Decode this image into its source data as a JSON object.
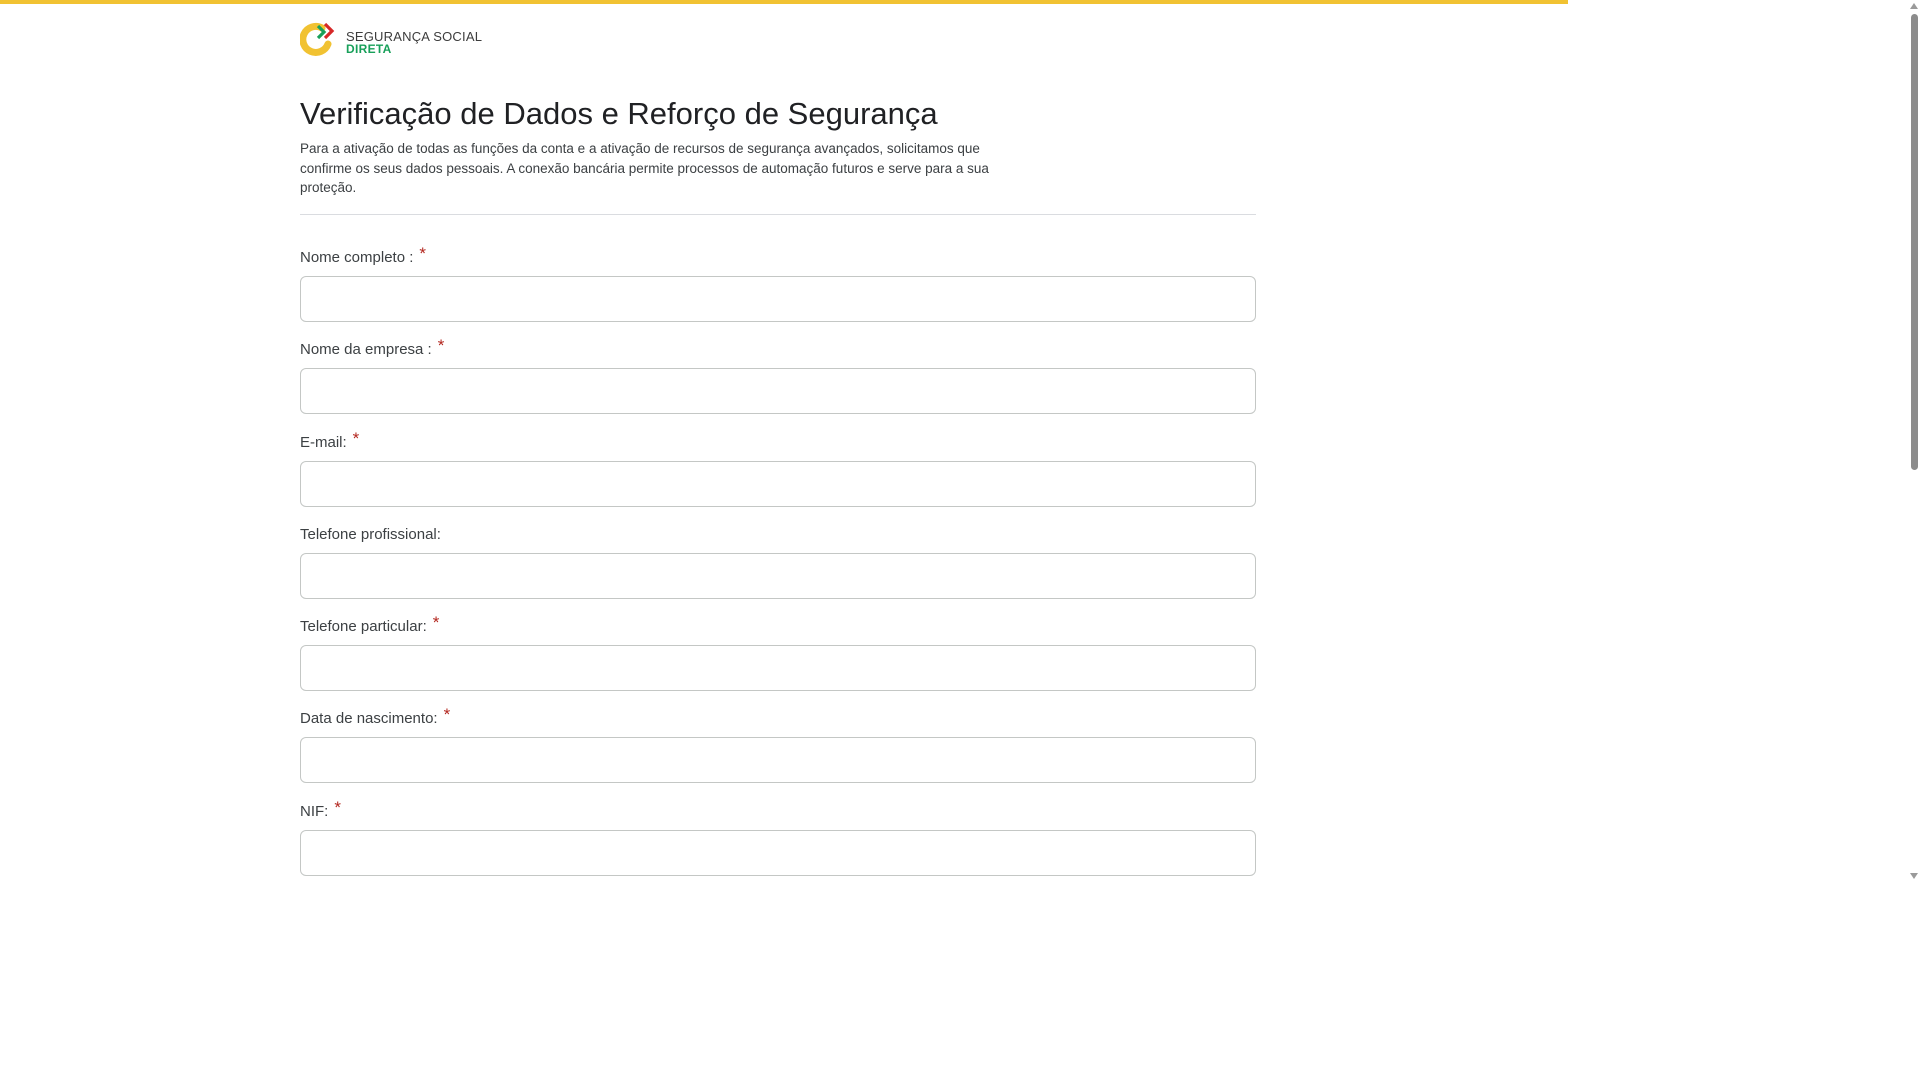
{
  "colors": {
    "top_bar": "#f1c232",
    "required_mark": "#b3261e",
    "brand_green": "#18a05a"
  },
  "header": {
    "logo_line1": "SEGURANÇA SOCIAL",
    "logo_line2": "DIRETA",
    "logo_icon": "seguranca-social-logo-icon"
  },
  "main": {
    "title": "Verificação de Dados e Reforço de Segurança",
    "intro": "Para a ativação de todas as funções da conta e a ativação de recursos de segurança avançados, solicitamos que confirme os seus dados pessoais. A conexão bancária permite processos de automação futuros e serve para a sua proteção."
  },
  "form": {
    "fields": [
      {
        "label": "Nome completo :",
        "required_mark": "*",
        "value": "",
        "placeholder": ""
      },
      {
        "label": "Nome da empresa :",
        "required_mark": "*",
        "value": "",
        "placeholder": ""
      },
      {
        "label": "E-mail:",
        "required_mark": "*",
        "value": "",
        "placeholder": ""
      },
      {
        "label": "Telefone profissional:",
        "required_mark": "",
        "value": "",
        "placeholder": ""
      },
      {
        "label": "Telefone particular:",
        "required_mark": "*",
        "value": "",
        "placeholder": ""
      },
      {
        "label": "Data de nascimento:",
        "required_mark": "*",
        "value": "",
        "placeholder": ""
      },
      {
        "label": "NIF:",
        "required_mark": "*",
        "value": "",
        "placeholder": ""
      }
    ]
  }
}
